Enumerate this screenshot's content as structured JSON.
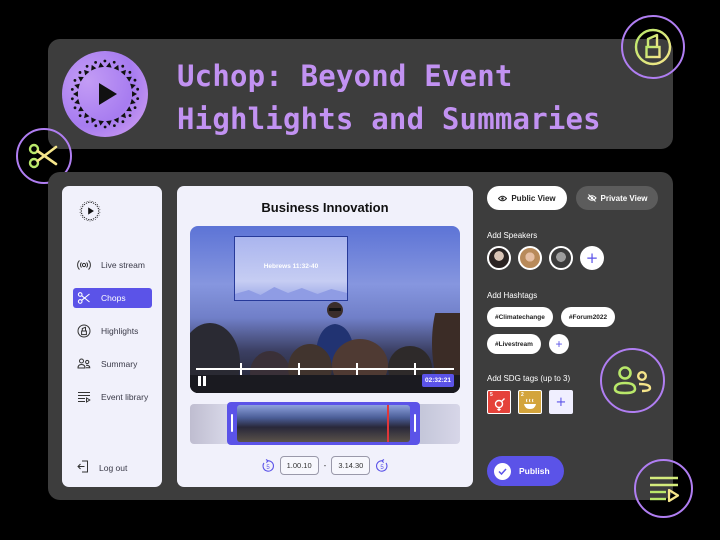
{
  "header": {
    "title_line1": "Uchop: Beyond Event",
    "title_line2": "Highlights and Summaries"
  },
  "floating_icons": [
    "lipstick-icon",
    "scissors-icon",
    "people-icon",
    "playlist-icon"
  ],
  "sidebar": {
    "items": [
      {
        "label": "Live stream",
        "icon": "broadcast-icon",
        "active": false
      },
      {
        "label": "Chops",
        "icon": "scissors-icon",
        "active": true
      },
      {
        "label": "Highlights",
        "icon": "highlight-icon",
        "active": false
      },
      {
        "label": "Summary",
        "icon": "people-icon",
        "active": false
      },
      {
        "label": "Event library",
        "icon": "playlist-icon",
        "active": false
      }
    ],
    "logout_label": "Log out"
  },
  "editor": {
    "title": "Business Innovation",
    "screen_text": "Hebrews 11:32-40",
    "current_time": "02:32:21",
    "trim_start": "1.00.10",
    "trim_separator": "-",
    "trim_end": "3.14.30",
    "skip_back_label": "5",
    "skip_forward_label": "5"
  },
  "right": {
    "public_view_label": "Public View",
    "private_view_label": "Private View",
    "speakers_label": "Add Speakers",
    "hashtags_label": "Add Hashtags",
    "hashtags": [
      "#Climatechange",
      "#Forum2022",
      "#Livestream"
    ],
    "sdg_label": "Add SDG tags (up to 3)",
    "sdg_tags": [
      {
        "number": "5",
        "name": "Gender Equality",
        "color": "#e5423a"
      },
      {
        "number": "2",
        "name": "Zero Hunger",
        "color": "#d3a43c"
      }
    ],
    "add_symbol": "+",
    "publish_label": "Publish"
  },
  "colors": {
    "accent": "#5b53e8",
    "title_purple": "#c292f2",
    "panel_bg": "#3d3d3d",
    "card_bg": "#f1f1fb"
  }
}
